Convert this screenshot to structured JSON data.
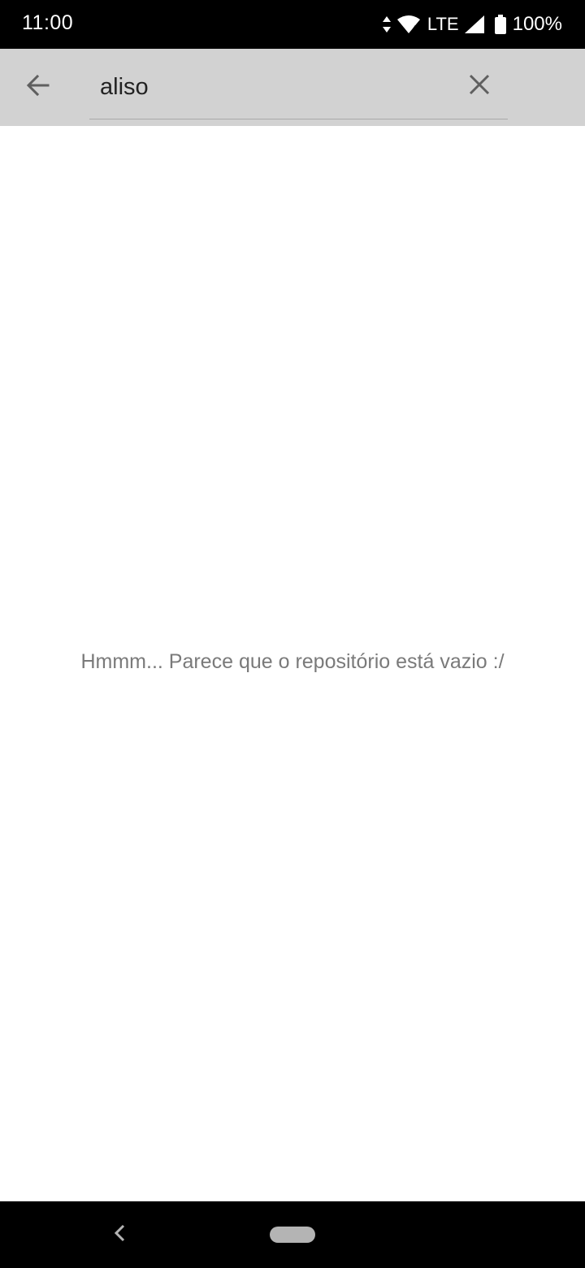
{
  "status_bar": {
    "time": "11:00",
    "network": "LTE",
    "battery": "100%",
    "icons": [
      "data-arrows-icon",
      "wifi-icon",
      "signal-icon",
      "battery-icon"
    ]
  },
  "search": {
    "value": "aliso",
    "back_icon": "arrow-back-icon",
    "clear_icon": "close-icon"
  },
  "main": {
    "empty_message": "Hmmm... Parece que o repositório está vazio :/"
  },
  "nav_bar": {
    "back_icon": "chevron-left-icon",
    "home_icon": "home-pill-icon"
  },
  "colors": {
    "status_bar_bg": "#000000",
    "app_bar_bg": "#d2d2d2",
    "message_text": "#7a7a7a"
  }
}
